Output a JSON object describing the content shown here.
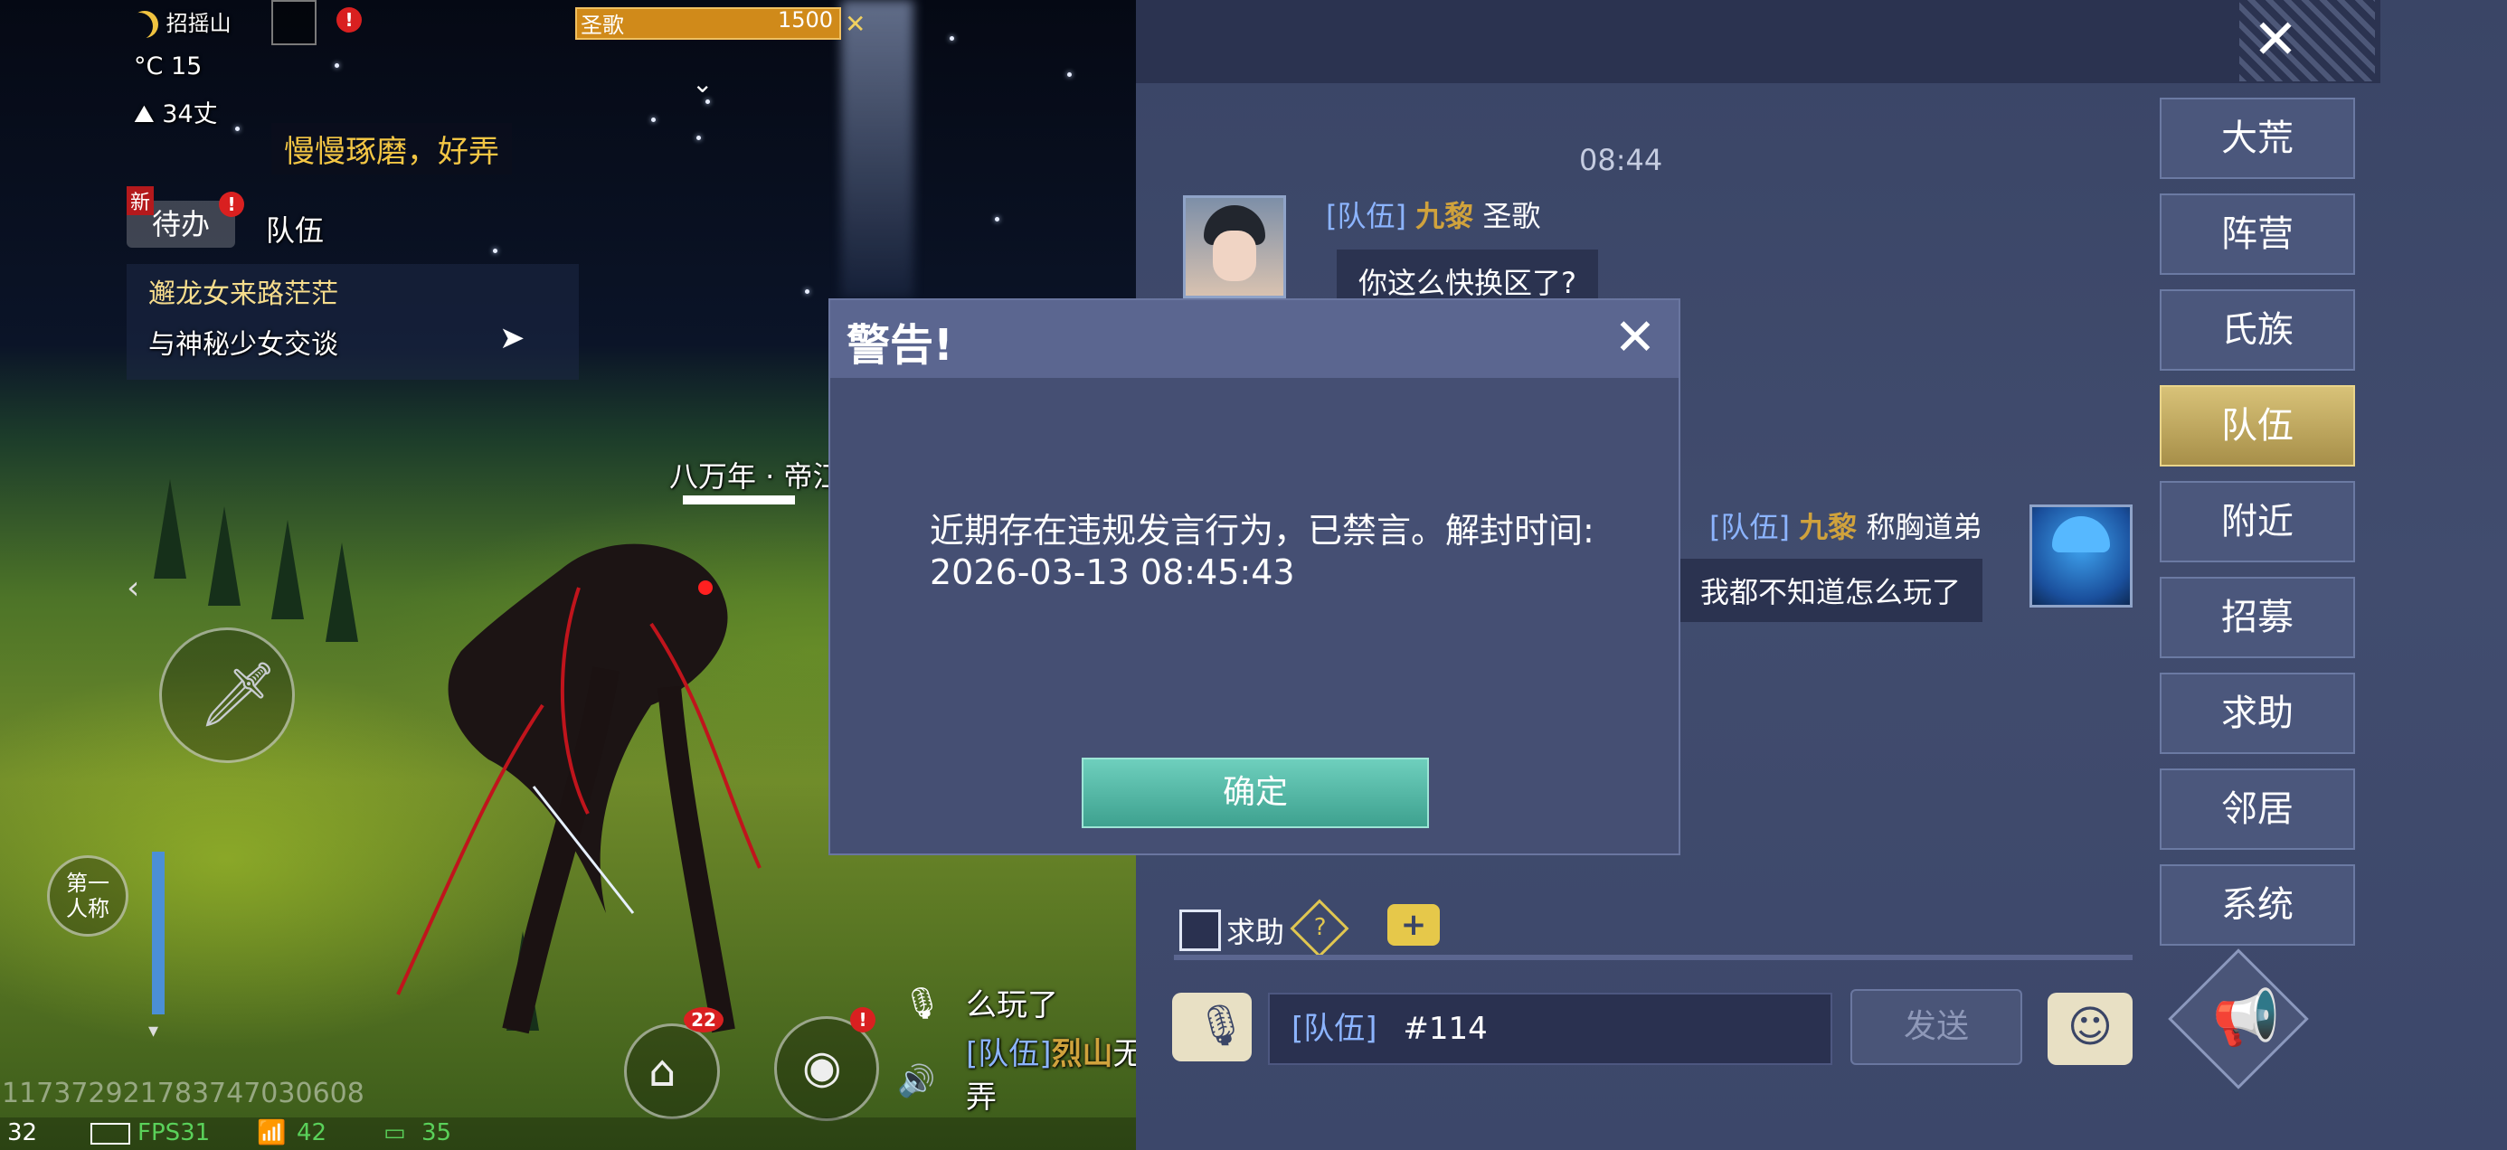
{
  "scene": {
    "location": "招摇山",
    "temperature": "15",
    "temperature_unit": "°C",
    "altitude": "34丈",
    "target_name": "圣歌",
    "target_hp": "1500",
    "hint_bubble": "慢慢琢磨，好弄",
    "new_badge": "新",
    "alert_mark": "!",
    "tabs": {
      "todo": "待办",
      "team": "队伍"
    },
    "quest_title": "邂龙女来路茫茫",
    "quest_step": "与神秘少女交谈",
    "region_label": "八万年 · 帝江",
    "view_mode": "第一\n人称",
    "house_badge": "22",
    "chat_preview": {
      "line1": "么玩了",
      "channel": "[队伍]",
      "guild": "烈山",
      "name_fragment": "无",
      "line2": "弄"
    },
    "player_id": "1173729217837470306​08",
    "status_bar": {
      "ping": "32",
      "fps": "FPS31",
      "wifi": "42",
      "msg_count": "35"
    }
  },
  "chat": {
    "timestamp": "08:44",
    "messages": [
      {
        "channel": "[队伍]",
        "guild": "九黎",
        "sender": "圣歌",
        "text": "你这么快换区了?",
        "side": "left"
      },
      {
        "channel": "[队伍]",
        "guild": "九黎",
        "sender": "称胸道弟",
        "text": "我都不知道怎么玩了",
        "side": "right"
      }
    ],
    "channels": [
      "大荒",
      "阵营",
      "氏族",
      "队伍",
      "附近",
      "招募",
      "求助",
      "邻居",
      "系统"
    ],
    "active_channel": "队伍",
    "help_checkbox_label": "求助",
    "help_mark": "?",
    "input": {
      "channel": "[队伍]",
      "value": "#114"
    },
    "send_label": "发送"
  },
  "dialog": {
    "title": "警告!",
    "message_line1": "近期存在违规发言行为，已禁言。解封时间:",
    "message_line2": "2026-03-13 08:45:43",
    "confirm_label": "确定"
  },
  "colors": {
    "accent_gold": "#d0a23c",
    "channel_blue": "#8cb4ff",
    "confirm_teal": "#4fb3a2",
    "active_tab": "#c9b26a"
  }
}
